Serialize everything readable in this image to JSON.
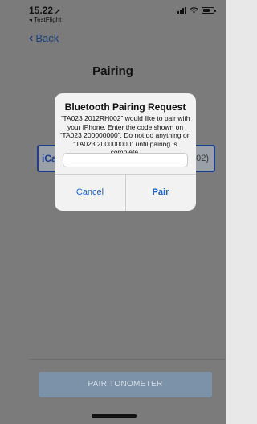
{
  "status_bar": {
    "time": "15.22",
    "location_icon": "location-arrow-icon",
    "back_to_app": "◂ TestFlight"
  },
  "nav": {
    "back_label": "Back",
    "back_icon": "chevron-left-icon"
  },
  "page": {
    "title": "Pairing"
  },
  "background_list": {
    "left_text": "iCa",
    "right_text": "02)"
  },
  "alert": {
    "title": "Bluetooth Pairing Request",
    "message": "“TA023 2012RH002” would like to pair with your iPhone. Enter the code shown on “TA023 200000000”. Do not do anything on “TA023 200000000” until pairing is complete.",
    "input_value": "",
    "cancel_label": "Cancel",
    "pair_label": "Pair"
  },
  "footer": {
    "pair_tonometer_label": "PAIR TONOMETER"
  },
  "colors": {
    "dim_overlay": "#7b7b7b",
    "accent_blue": "#1a64d1",
    "nav_blue": "#1b3f7a",
    "button_bg": "#7b92a8"
  }
}
